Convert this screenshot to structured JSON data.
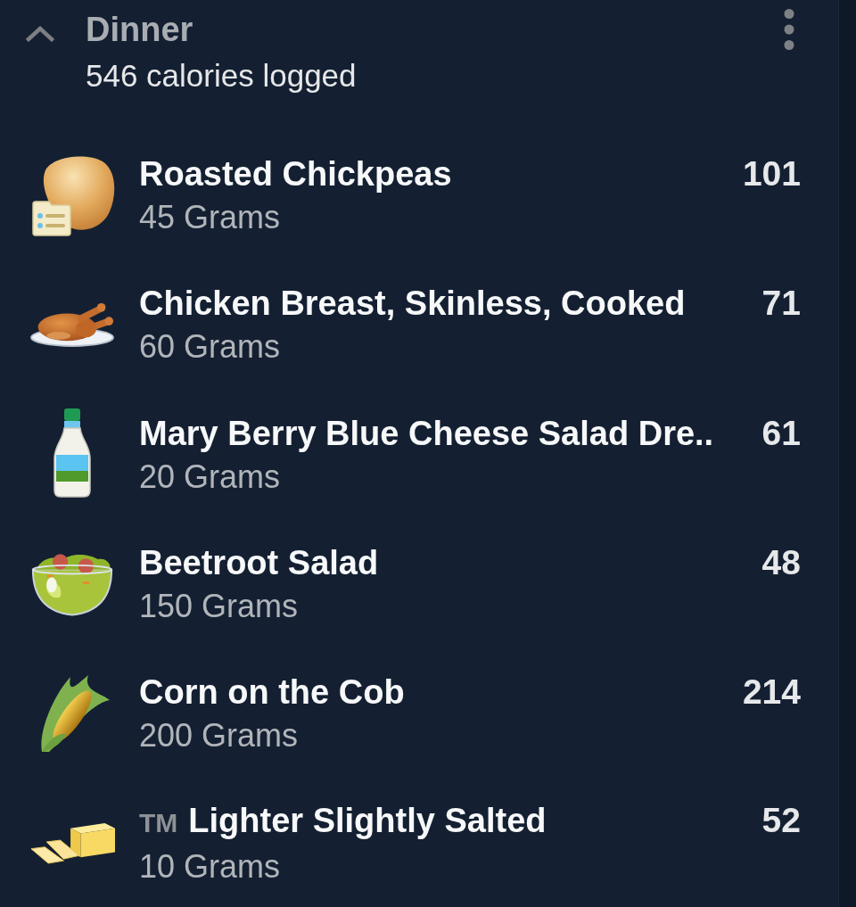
{
  "section": {
    "title": "Dinner",
    "subtitle": "546 calories logged",
    "expanded": true
  },
  "entries": [
    {
      "kind": "chickpeas",
      "recipe": true,
      "name": "Roasted Chickpeas",
      "amount": "45 Grams",
      "calories": "101"
    },
    {
      "kind": "chicken",
      "recipe": false,
      "name": "Chicken Breast, Skinless, Cooked",
      "amount": "60 Grams",
      "calories": "71"
    },
    {
      "kind": "dressing",
      "recipe": false,
      "name": "Mary Berry Blue Cheese Salad Dre..",
      "amount": "20 Grams",
      "calories": "61"
    },
    {
      "kind": "salad",
      "recipe": false,
      "name": "Beetroot Salad",
      "amount": "150 Grams",
      "calories": "48"
    },
    {
      "kind": "corn",
      "recipe": false,
      "name": "Corn on the Cob",
      "amount": "200 Grams",
      "calories": "214"
    },
    {
      "kind": "butter",
      "recipe": false,
      "brand_mark": "TM",
      "name": "Lighter Slightly Salted",
      "amount": "10 Grams",
      "calories": "52"
    }
  ]
}
